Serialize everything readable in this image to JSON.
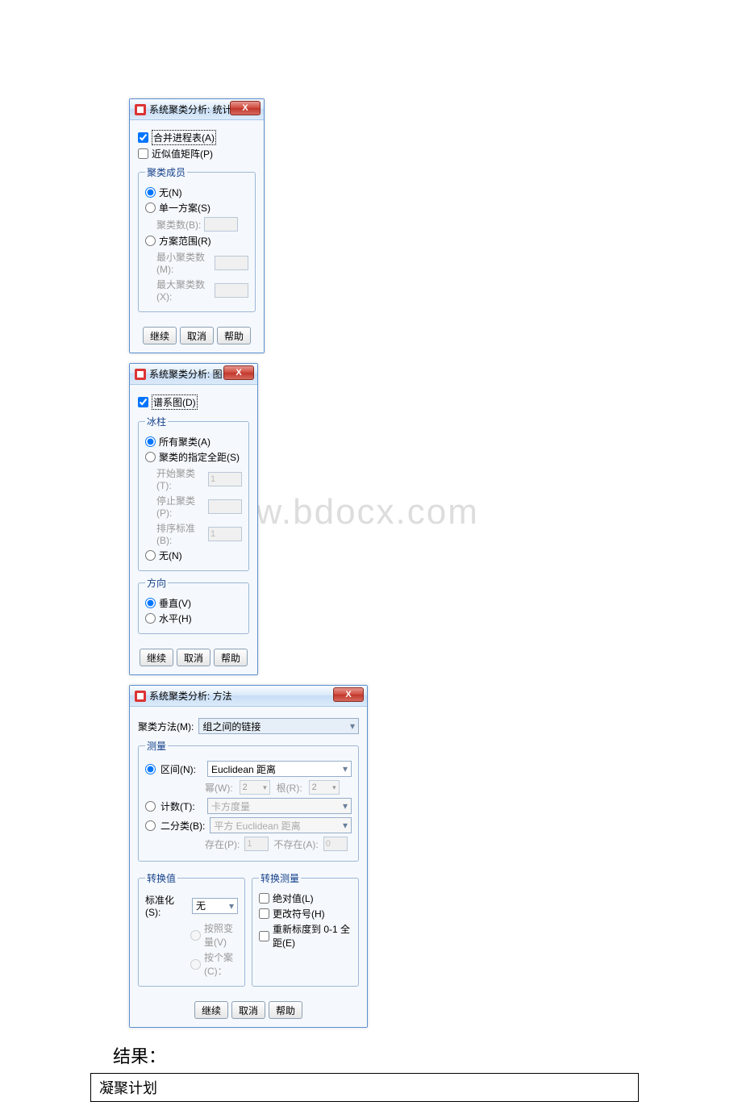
{
  "watermark": "www.bdocx.com",
  "dialog1": {
    "title": "系统聚类分析: 统计",
    "close": "X",
    "merge_table": "合并进程表(A)",
    "prox_matrix": "近似值矩阵(P)",
    "group_members": "聚类成员",
    "none": "无(N)",
    "single": "单一方案(S)",
    "clusters_label": "聚类数(B):",
    "range": "方案范围(R)",
    "min_label": "最小聚类数(M):",
    "max_label": "最大聚类数(X):",
    "continue": "继续",
    "cancel": "取消",
    "help": "帮助"
  },
  "dialog2": {
    "title": "系统聚类分析: 图",
    "close": "X",
    "dendrogram": "谱系图(D)",
    "icicle_legend": "冰柱",
    "all_clusters": "所有聚类(A)",
    "specified_range": "聚类的指定全距(S)",
    "start_label": "开始聚类(T):",
    "start_val": "1",
    "stop_label": "停止聚类(P):",
    "by_label": "排序标准(B):",
    "by_val": "1",
    "none": "无(N)",
    "orientation_legend": "方向",
    "vertical": "垂直(V)",
    "horizontal": "水平(H)",
    "continue": "继续",
    "cancel": "取消",
    "help": "帮助"
  },
  "dialog3": {
    "title": "系统聚类分析: 方法",
    "close": "X",
    "method_label": "聚类方法(M):",
    "method_value": "组之间的链接",
    "measure_legend": "测量",
    "interval": "区间(N):",
    "interval_value": "Euclidean 距离",
    "power_label": "幂(W):",
    "power_val": "2",
    "root_label": "根(R):",
    "root_val": "2",
    "count": "计数(T):",
    "count_value": "卡方度量",
    "binary": "二分类(B):",
    "binary_value": "平方 Euclidean 距离",
    "present_label": "存在(P):",
    "present_val": "1",
    "absent_label": "不存在(A):",
    "absent_val": "0",
    "transform_legend": "转换值",
    "standardize_label": "标准化(S):",
    "standardize_value": "无",
    "by_variable": "按照变量(V)",
    "by_case": "按个案(C)：",
    "transform_measure_legend": "转换测量",
    "absolute": "绝对值(L)",
    "change_sign": "更改符号(H)",
    "rescale": "重新标度到 0-1 全距(E)",
    "continue": "继续",
    "cancel": "取消",
    "help": "帮助"
  },
  "result_label": "结果：",
  "result_cell": "凝聚计划"
}
